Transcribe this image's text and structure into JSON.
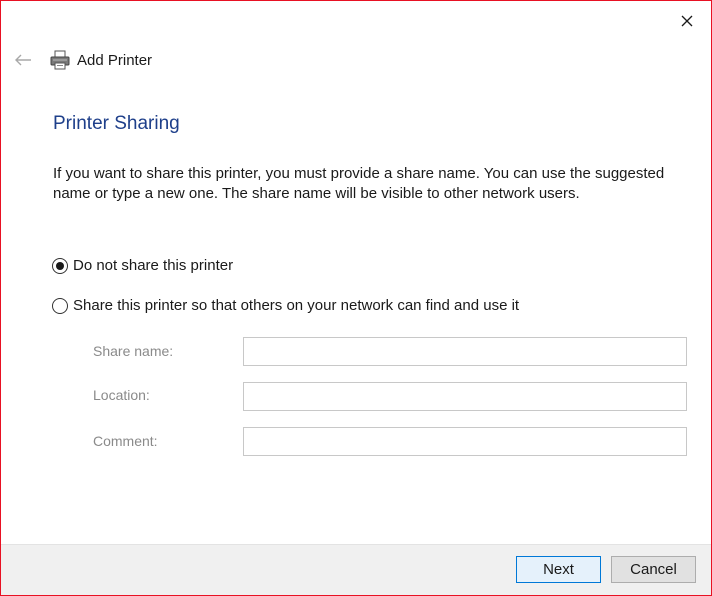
{
  "window": {
    "border_color": "#e81123",
    "close_icon": "close-icon"
  },
  "header": {
    "back_icon": "back-arrow-icon",
    "printer_icon": "printer-icon",
    "title": "Add Printer"
  },
  "page": {
    "title": "Printer Sharing",
    "title_color": "#1e3f8a",
    "description": "If you want to share this printer, you must provide a share name. You can use the suggested name or type a new one. The share name will be visible to other network users."
  },
  "sharing_options": [
    {
      "label": "Do not share this printer",
      "selected": true
    },
    {
      "label": "Share this printer so that others on your network can find and use it",
      "selected": false
    }
  ],
  "fields": {
    "share_name": {
      "label": "Share name:",
      "value": "",
      "enabled": false
    },
    "location": {
      "label": "Location:",
      "value": "",
      "enabled": false
    },
    "comment": {
      "label": "Comment:",
      "value": "",
      "enabled": false
    }
  },
  "footer": {
    "next_label": "Next",
    "cancel_label": "Cancel",
    "accent": "#0078d7"
  }
}
